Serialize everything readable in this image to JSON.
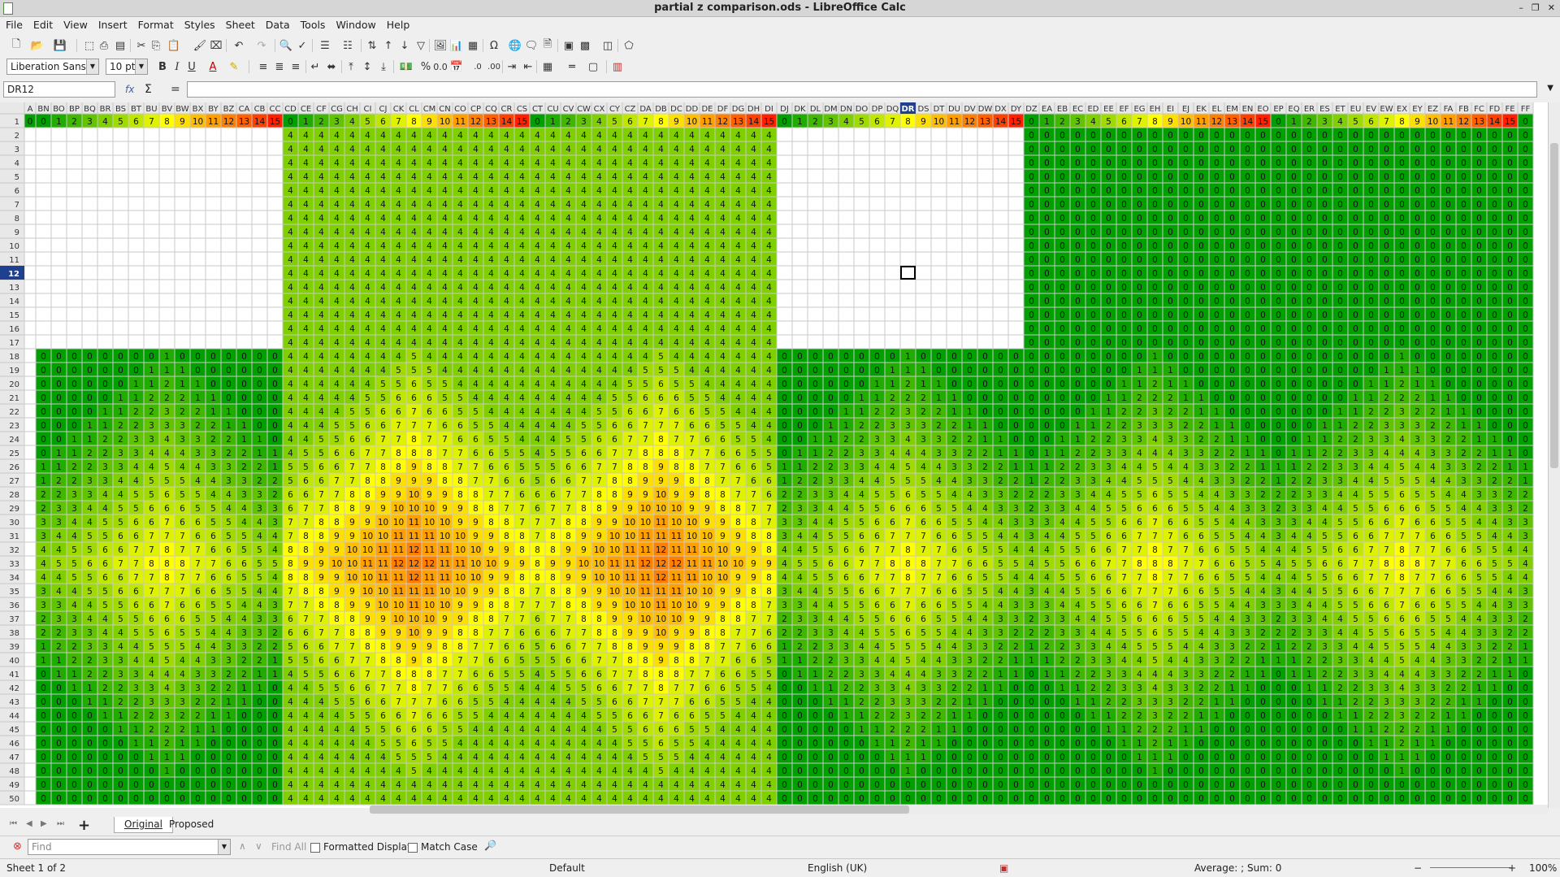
{
  "window": {
    "title": "partial z comparison.ods - LibreOffice Calc"
  },
  "menu": [
    "File",
    "Edit",
    "View",
    "Insert",
    "Format",
    "Styles",
    "Sheet",
    "Data",
    "Tools",
    "Window",
    "Help"
  ],
  "formatting": {
    "font_name": "Liberation Sans",
    "font_size": "10 pt"
  },
  "formula_bar": {
    "cell_ref": "DR12",
    "content": "",
    "fx": "fx",
    "sigma": "Σ",
    "equals": "="
  },
  "sheet": {
    "column_letters": [
      "A",
      "BN",
      "BO",
      "BP",
      "BQ",
      "BR",
      "BS",
      "BT",
      "BU",
      "BV",
      "BW",
      "BX",
      "BY",
      "BZ",
      "CA",
      "CB",
      "CC",
      "CD",
      "CE",
      "CF",
      "CG",
      "CH",
      "CI",
      "CJ",
      "CK",
      "CL",
      "CM",
      "CN",
      "CO",
      "CP",
      "CQ",
      "CR",
      "CS",
      "CT",
      "CU",
      "CV",
      "CW",
      "CX",
      "CY",
      "CZ",
      "DA",
      "DB",
      "DC",
      "DD",
      "DE",
      "DF",
      "DG",
      "DH",
      "DI",
      "DJ",
      "DK",
      "DL",
      "DM",
      "DN",
      "DO",
      "DP",
      "DQ",
      "DR",
      "DS",
      "DT",
      "DU",
      "DV",
      "DW",
      "DX",
      "DY",
      "DZ",
      "EA",
      "EB",
      "EC",
      "ED",
      "EE",
      "EF",
      "EG",
      "EH",
      "EI",
      "EJ",
      "EK",
      "EL",
      "EM",
      "EN",
      "EO",
      "EP",
      "EQ",
      "ER",
      "ES",
      "ET",
      "EU",
      "EV",
      "EW",
      "EX",
      "EY",
      "EZ",
      "FA",
      "FB",
      "FC",
      "FD",
      "FE",
      "FF"
    ],
    "first_row": 1,
    "last_row": 50,
    "selected_column": "DR",
    "selected_row": 12,
    "color_scale": {
      "low": "#00a000",
      "mid": "#ffff00",
      "high": "#ff0000"
    }
  },
  "tabs": [
    {
      "label": "Original",
      "active": true
    },
    {
      "label": "Proposed",
      "active": false
    }
  ],
  "find": {
    "placeholder": "Find",
    "find_all": "Find All",
    "formatted_display": "Formatted Display",
    "match_case": "Match Case"
  },
  "status": {
    "sheet": "Sheet 1 of 2",
    "page_style": "Default",
    "language": "English (UK)",
    "summary": "Average: ; Sum: 0",
    "zoom": "100%"
  }
}
